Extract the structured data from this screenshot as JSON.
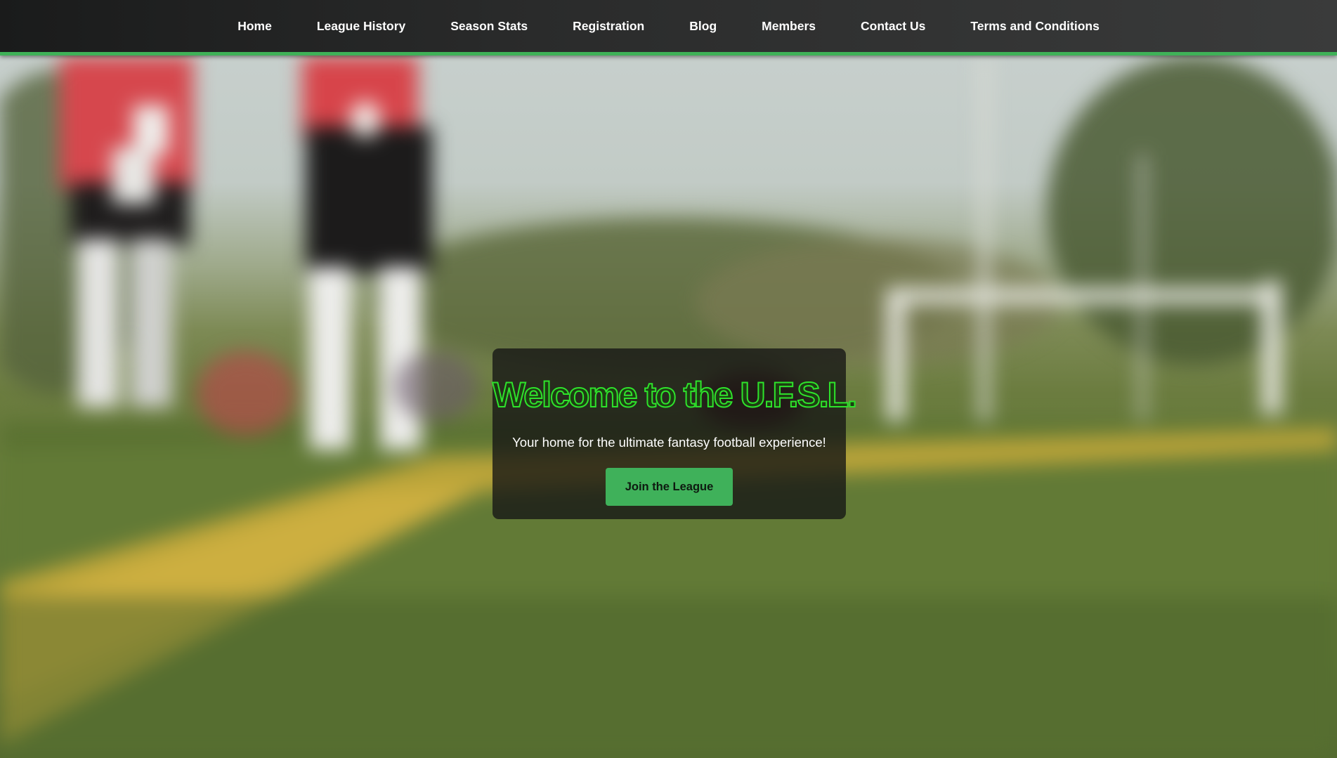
{
  "nav": {
    "items": [
      {
        "label": "Home"
      },
      {
        "label": "League History"
      },
      {
        "label": "Season Stats"
      },
      {
        "label": "Registration"
      },
      {
        "label": "Blog"
      },
      {
        "label": "Members"
      },
      {
        "label": "Contact Us"
      },
      {
        "label": "Terms and Conditions"
      }
    ]
  },
  "hero": {
    "title": "Welcome to the U.F.S.L.",
    "subtitle": "Your home for the ultimate fantasy football experience!",
    "cta_label": "Join the League"
  },
  "colors": {
    "accent": "#3fb158",
    "title_outline": "#2ee32b",
    "nav_background": "#2a2b2b"
  }
}
